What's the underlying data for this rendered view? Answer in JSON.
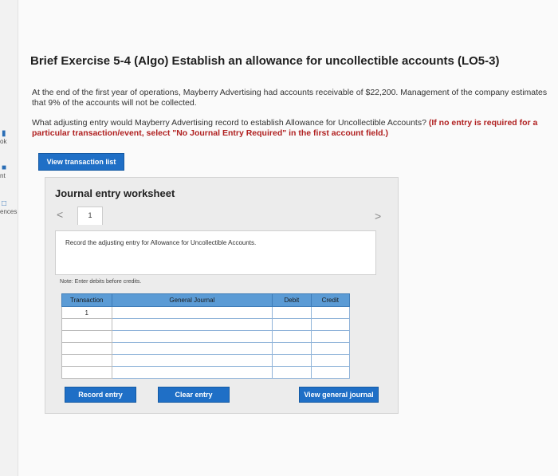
{
  "sidebar": {
    "items": [
      {
        "icon": "book-icon",
        "label": "ok"
      },
      {
        "icon": "print-icon",
        "label": "nt"
      },
      {
        "icon": "references-icon",
        "label": "ences"
      }
    ]
  },
  "exercise": {
    "title": "Brief Exercise 5-4 (Algo) Establish an allowance for uncollectible accounts (LO5-3)",
    "paragraph1": "At the end of the first year of operations, Mayberry Advertising had accounts receivable of $22,200. Management of the company estimates that 9% of the accounts will not be collected.",
    "question": "What adjusting entry would Mayberry Advertising record to establish Allowance for Uncollectible Accounts?",
    "instruction": "(If no entry is required for a particular transaction/event, select \"No Journal Entry Required\" in the first account field.)"
  },
  "buttons": {
    "view_transaction_list": "View transaction list",
    "record_entry": "Record entry",
    "clear_entry": "Clear entry",
    "view_general_journal": "View general journal"
  },
  "worksheet": {
    "title": "Journal entry worksheet",
    "prev": "<",
    "next": ">",
    "tab_number": "1",
    "entry_prompt": "Record the adjusting entry for Allowance for Uncollectible Accounts.",
    "note": "Note: Enter debits before credits."
  },
  "journal": {
    "headers": {
      "transaction": "Transaction",
      "general_journal": "General Journal",
      "debit": "Debit",
      "credit": "Credit"
    },
    "rows": [
      {
        "transaction": "1"
      },
      {
        "transaction": ""
      },
      {
        "transaction": ""
      },
      {
        "transaction": ""
      },
      {
        "transaction": ""
      },
      {
        "transaction": ""
      }
    ]
  },
  "colors": {
    "primary_button": "#1f6fc6",
    "table_header": "#5b9bd5",
    "instruction_red": "#b02020"
  }
}
